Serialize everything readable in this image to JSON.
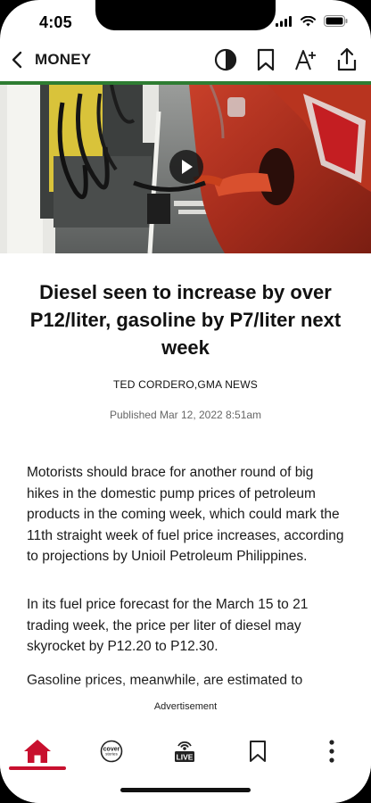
{
  "status_bar": {
    "time": "4:05"
  },
  "header": {
    "section": "MONEY"
  },
  "hero": {
    "alt_icons": [
      "play-icon"
    ]
  },
  "article": {
    "title": "Diesel seen to increase by over P12/liter, gasoline by P7/liter next week",
    "byline": "TED CORDERO,GMA NEWS",
    "published": "Published Mar 12, 2022 8:51am",
    "paragraphs": [
      "Motorists should brace for another round of big hikes in the domestic pump prices of petroleum products in the coming week, which could mark the 11th straight week of fuel price increases, according to projections by Unioil Petroleum Philippines.",
      "In its fuel price forecast for the March 15 to 21 trading week, the price per liter of diesel may skyrocket by P12.20 to P12.30.",
      "Gasoline prices, meanwhile, are estimated to"
    ]
  },
  "ad": {
    "label": "Advertisement"
  },
  "bottom_nav": {
    "cover_label_1": "cover",
    "cover_label_2": "stories",
    "live_label": "LIVE"
  },
  "colors": {
    "accent_green": "#2e7d32",
    "active_red": "#c8102e"
  },
  "icons": [
    "back-chevron-icon",
    "contrast-icon",
    "bookmark-icon",
    "text-size-icon",
    "share-icon",
    "home-icon",
    "cover-stories-icon",
    "live-icon",
    "more-icon"
  ]
}
